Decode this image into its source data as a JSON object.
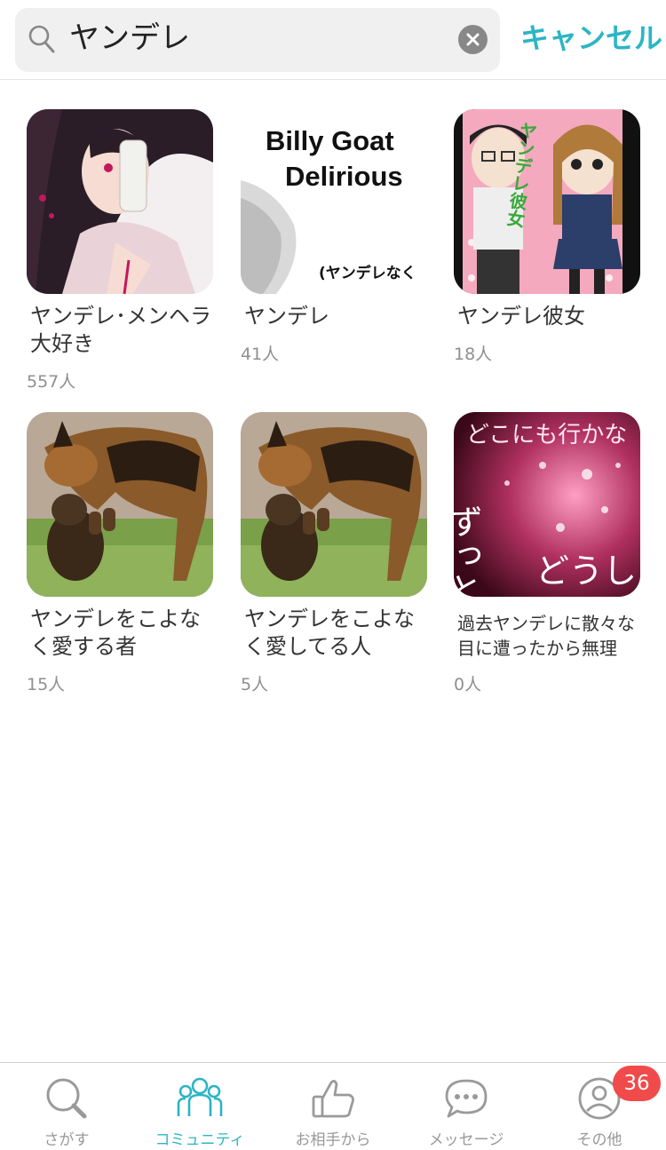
{
  "search": {
    "query": "ヤンデレ",
    "cancel_label": "キャンセル"
  },
  "communities": [
    {
      "title": "ヤンデレ･メンヘラ大好き",
      "count": "557人",
      "thumb": "anime-girl-bandaged"
    },
    {
      "title": "ヤンデレ",
      "count": "41人",
      "thumb": "billy-goat",
      "thumb_text": [
        "Billy Goat",
        "Delirious",
        "(ヤンデレなく"
      ]
    },
    {
      "title": "ヤンデレ彼女",
      "count": "18人",
      "thumb": "manga-cover",
      "thumb_text": "ヤンデレ彼女"
    },
    {
      "title": "ヤンデレをこよなく愛する者",
      "count": "15人",
      "thumb": "shepherd-dogs"
    },
    {
      "title": "ヤンデレをこよなく愛してる人",
      "count": "5人",
      "thumb": "shepherd-dogs"
    },
    {
      "title": "過去ヤンデレに散々な目に遭ったから無理",
      "count": "0人",
      "thumb": "pink-sparkle-text",
      "thumb_text": [
        "どこにも行かな",
        "ずっとそば",
        "どうし"
      ]
    }
  ],
  "tabbar": {
    "tabs": [
      {
        "label": "さがす",
        "icon": "search-icon"
      },
      {
        "label": "コミュニティ",
        "icon": "community-icon"
      },
      {
        "label": "お相手から",
        "icon": "thumbs-up-icon"
      },
      {
        "label": "メッセージ",
        "icon": "chat-bubble-icon"
      },
      {
        "label": "その他",
        "icon": "profile-icon"
      }
    ],
    "active_index": 1,
    "badge_count": "36"
  },
  "colors": {
    "accent": "#2cb5c4",
    "badge": "#f04a4a",
    "muted_text": "#8f8f8f"
  }
}
